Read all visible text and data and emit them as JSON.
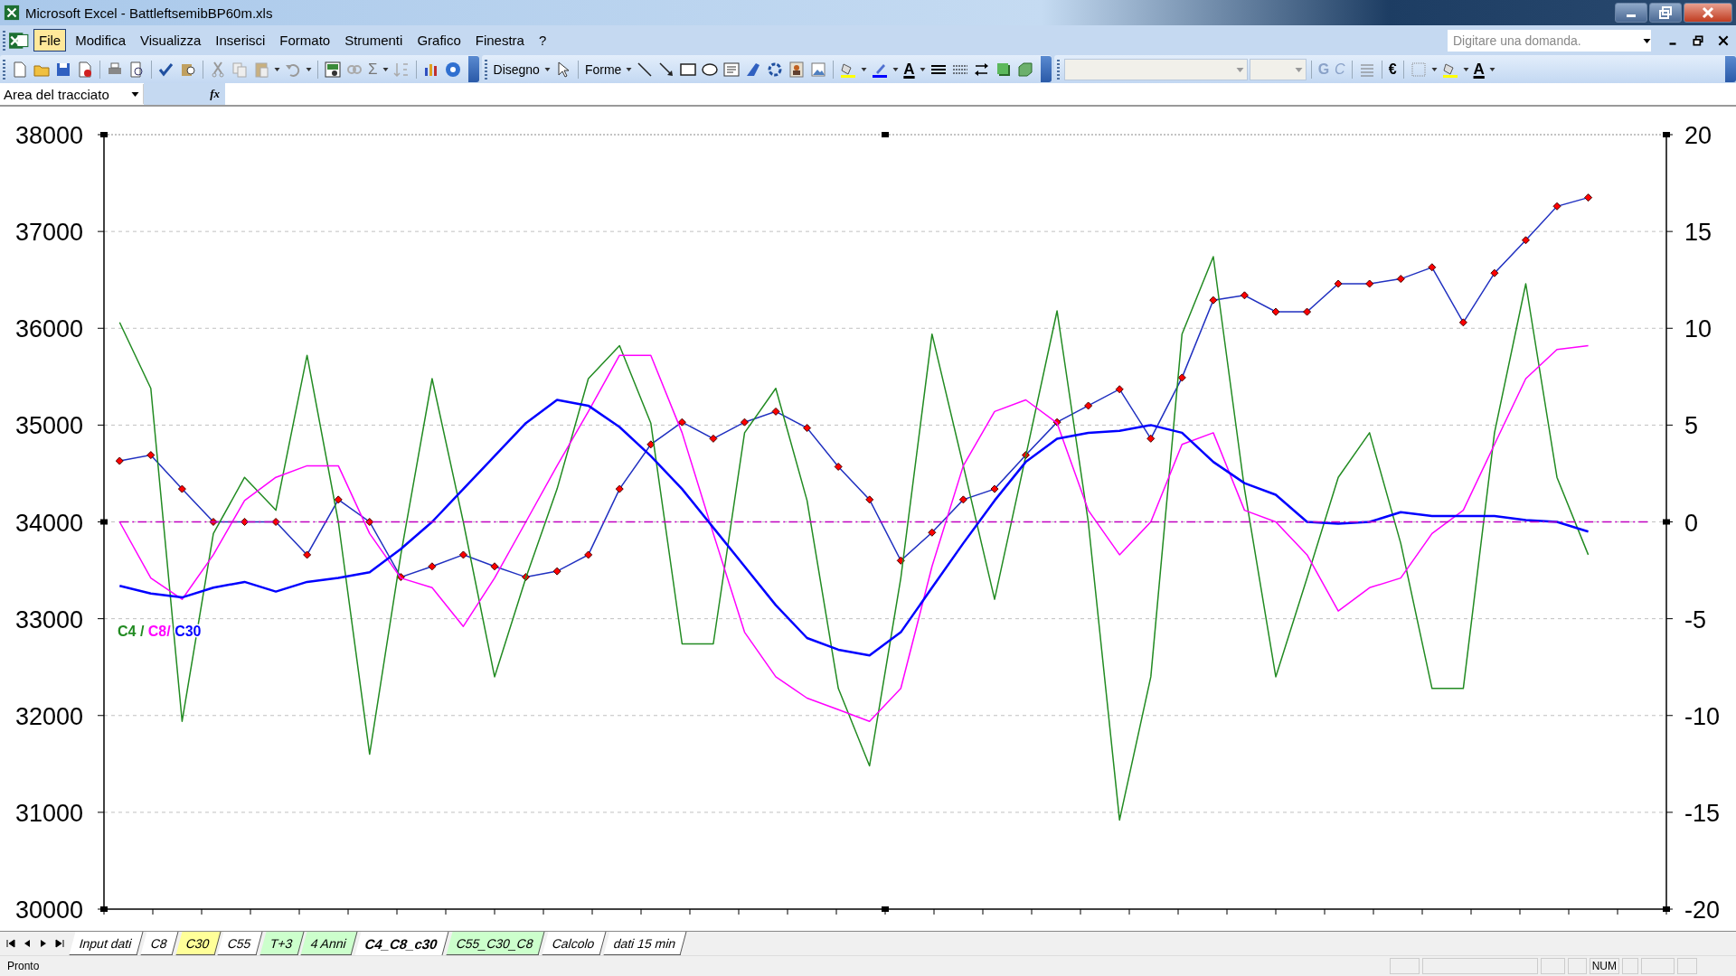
{
  "window": {
    "title": "Microsoft Excel - BattleftsemibBP60m.xls"
  },
  "menu": [
    {
      "label": "File",
      "selected": true
    },
    {
      "label": "Modifica",
      "selected": false
    },
    {
      "label": "Visualizza",
      "selected": false
    },
    {
      "label": "Inserisci",
      "selected": false
    },
    {
      "label": "Formato",
      "selected": false
    },
    {
      "label": "Strumenti",
      "selected": false
    },
    {
      "label": "Grafico",
      "selected": false
    },
    {
      "label": "Finestra",
      "selected": false
    },
    {
      "label": "?",
      "selected": false
    }
  ],
  "help_search": {
    "placeholder": "Digitare una domanda."
  },
  "toolbar": {
    "autosum": "Σ",
    "drawing_menu": "Disegno",
    "shapes_menu": "Forme",
    "font_color_letter": "A",
    "bold": "G",
    "italic": "C",
    "euro": "€",
    "font_color_letter_2": "A"
  },
  "name_box": {
    "value": "Area del tracciato"
  },
  "formula_bar": {
    "function_label": "fx"
  },
  "chart": {
    "price": {
      "chart_data": {
        "type": "line",
        "categories": [
          null,
          null,
          null,
          null,
          null,
          null,
          null,
          null,
          null,
          null,
          null,
          null,
          null,
          null,
          null,
          null,
          null,
          null,
          null,
          null,
          null,
          null,
          null,
          null,
          null,
          null,
          null,
          null,
          null,
          null,
          null,
          null,
          null,
          null,
          null,
          null,
          null,
          null,
          null,
          null,
          null,
          null,
          null,
          null,
          null,
          null,
          null,
          null,
          null,
          null
        ],
        "grid": true,
        "ylim": [
          30000,
          38000
        ],
        "yticks": [
          30000,
          31000,
          32000,
          33000,
          34000,
          35000,
          36000,
          37000,
          38000
        ],
        "series": [
          {
            "color": "#2030c0",
            "marker": "diamond",
            "values": [
              34630,
              34690,
              34340,
              34000,
              34000,
              34000,
              33660,
              34230,
              34000,
              33430,
              33540,
              33660,
              33540,
              33430,
              33490,
              33660,
              34340,
              34800,
              35030,
              34860,
              35030,
              35140,
              34970,
              34570,
              34230,
              33600,
              33890,
              34230,
              34340,
              34690,
              35030,
              35200,
              35370,
              34860,
              35490,
              36290,
              36340,
              36170,
              36170,
              36460,
              36460,
              36510,
              36630,
              36060,
              36570,
              36910,
              37260,
              37350,
              null,
              null
            ]
          }
        ]
      }
    },
    "oscillators": {
      "chart_data": {
        "type": "line",
        "categories": [
          null,
          null,
          null,
          null,
          null,
          null,
          null,
          null,
          null,
          null,
          null,
          null,
          null,
          null,
          null,
          null,
          null,
          null,
          null,
          null,
          null,
          null,
          null,
          null,
          null,
          null,
          null,
          null,
          null,
          null,
          null,
          null,
          null,
          null,
          null,
          null,
          null,
          null,
          null,
          null,
          null,
          null,
          null,
          null,
          null,
          null,
          null,
          null,
          null,
          null
        ],
        "ylim": [
          -20,
          20
        ],
        "yticks": [
          -20,
          -15,
          -10,
          -5,
          0,
          5,
          10,
          15,
          20
        ],
        "series": [
          {
            "name": "C4",
            "color": "#228b22",
            "values": [
              10.3,
              6.9,
              -10.3,
              -0.6,
              2.3,
              0.6,
              8.6,
              0,
              -12,
              -1.7,
              7.4,
              0,
              -8,
              -2.9,
              1.7,
              7.4,
              9.1,
              5.1,
              -6.3,
              -6.3,
              4.6,
              6.9,
              1.1,
              -8.6,
              -12.6,
              -2.9,
              9.7,
              2.9,
              -4,
              3.4,
              10.9,
              0,
              -15.4,
              -8,
              9.7,
              13.7,
              1.7,
              -8,
              -2.9,
              2.3,
              4.6,
              -1.1,
              -8.6,
              -8.6,
              4.6,
              12.3,
              2.3,
              -1.7,
              null,
              null
            ]
          },
          {
            "name": "C8",
            "color": "#ff00ff",
            "values": [
              0,
              -2.9,
              -4,
              -1.7,
              1.1,
              2.3,
              2.9,
              2.9,
              -0.6,
              -2.9,
              -3.4,
              -5.4,
              -2.9,
              0,
              2.9,
              5.7,
              8.6,
              8.6,
              4.6,
              -0.6,
              -5.7,
              -8,
              -9.1,
              -9.7,
              -10.3,
              -8.6,
              -2.3,
              2.9,
              5.7,
              6.3,
              5.1,
              0.6,
              -1.7,
              0,
              4,
              4.6,
              0.6,
              0,
              -1.7,
              -4.6,
              -3.4,
              -2.9,
              -0.6,
              0.6,
              4,
              7.4,
              8.9,
              9.1,
              null,
              null
            ]
          },
          {
            "name": "C30",
            "color": "#0000ff",
            "values": [
              -3.3,
              -3.7,
              -3.9,
              -3.4,
              -3.1,
              -3.6,
              -3.1,
              -2.9,
              -2.6,
              -1.4,
              0,
              1.7,
              3.4,
              5.1,
              6.3,
              6,
              4.9,
              3.4,
              1.7,
              -0.3,
              -2.3,
              -4.3,
              -6,
              -6.6,
              -6.9,
              -5.7,
              -3.4,
              -1.1,
              1.1,
              3.1,
              4.3,
              4.6,
              4.7,
              5,
              4.6,
              3.1,
              2,
              1.4,
              0,
              -0.1,
              0,
              0.5,
              0.3,
              0.3,
              0.3,
              0.1,
              0,
              -0.5,
              null,
              null
            ]
          },
          {
            "color": "#c000c0",
            "line_style": "dashdot",
            "values": [
              0,
              0,
              0,
              0,
              0,
              0,
              0,
              0,
              0,
              0,
              0,
              0,
              0,
              0,
              0,
              0,
              0,
              0,
              0,
              0,
              0,
              0,
              0,
              0,
              0,
              0,
              0,
              0,
              0,
              0,
              0,
              0,
              0,
              0,
              0,
              0,
              0,
              0,
              0,
              0,
              0,
              0,
              0,
              0,
              0,
              0,
              0,
              0,
              0,
              0
            ]
          }
        ],
        "annotations": [
          {
            "text": "/"
          },
          {
            "text": "/"
          }
        ]
      }
    }
  },
  "sheet_tabs": [
    {
      "label": "Input dati",
      "selected": false
    },
    {
      "label": "C8",
      "selected": false
    },
    {
      "label": "C30",
      "selected": false,
      "color": "#ffff99"
    },
    {
      "label": "C55",
      "selected": false
    },
    {
      "label": "T+3",
      "selected": false,
      "color": "#ccffcc"
    },
    {
      "label": "4 Anni",
      "selected": false,
      "color": "#ccffcc"
    },
    {
      "label": "C4_C8_c30",
      "selected": true
    },
    {
      "label": "C55_C30_C8",
      "selected": false,
      "color": "#ccffcc"
    },
    {
      "label": "Calcolo",
      "selected": false
    },
    {
      "label": "dati 15 min",
      "selected": false
    }
  ],
  "status_bar": {
    "status": "Pronto",
    "num_lock": "NUM"
  }
}
